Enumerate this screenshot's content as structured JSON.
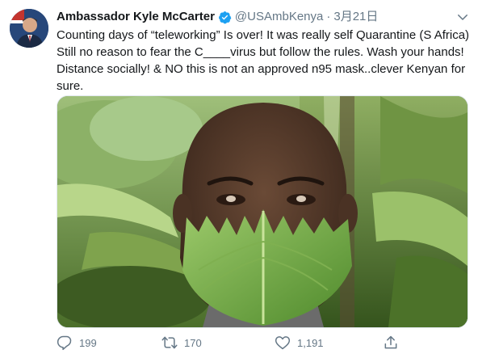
{
  "tweet": {
    "author_name": "Ambassador Kyle McCarter",
    "handle": "@USAmbKenya",
    "separator": "·",
    "date": "3月21日",
    "text": "Counting days of “teleworking” Is over! It was really self Quarantine (S Africa) Still no reason to fear the C____virus but follow the rules. Wash your hands! Distance socially! & NO this is not an approved n95 mask..clever Kenyan for sure."
  },
  "actions": {
    "replies": "199",
    "retweets": "170",
    "likes": "1,191"
  },
  "icons": {
    "verified": "verified-badge-icon",
    "caret": "chevron-down-icon",
    "reply": "reply-icon",
    "retweet": "retweet-icon",
    "like": "heart-icon",
    "share": "share-icon"
  },
  "colors": {
    "verified": "#1da1f2",
    "secondary_text": "#657786",
    "primary_text": "#14171a"
  }
}
